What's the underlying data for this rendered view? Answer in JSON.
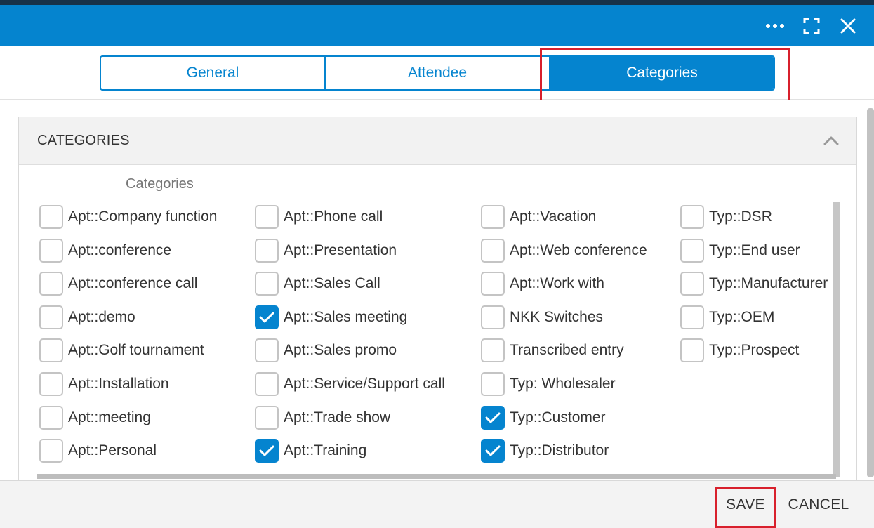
{
  "colors": {
    "accent": "#0584cf",
    "highlight": "#d8202c",
    "titlebar": "#0584cf",
    "top_strip": "#17324a"
  },
  "titlebar": {
    "icons": [
      "more-icon",
      "maximize-icon",
      "close-icon"
    ]
  },
  "tabs": [
    {
      "label": "General",
      "active": false
    },
    {
      "label": "Attendee",
      "active": false
    },
    {
      "label": "Categories",
      "active": true
    }
  ],
  "panel": {
    "title": "CATEGORIES",
    "field_label": "Categories"
  },
  "categories": [
    [
      {
        "label": "Apt::Company function",
        "checked": false
      },
      {
        "label": "Apt::conference",
        "checked": false
      },
      {
        "label": "Apt::conference call",
        "checked": false
      },
      {
        "label": "Apt::demo",
        "checked": false
      },
      {
        "label": "Apt::Golf tournament",
        "checked": false
      },
      {
        "label": "Apt::Installation",
        "checked": false
      },
      {
        "label": "Apt::meeting",
        "checked": false
      },
      {
        "label": "Apt::Personal",
        "checked": false
      }
    ],
    [
      {
        "label": "Apt::Phone call",
        "checked": false
      },
      {
        "label": "Apt::Presentation",
        "checked": false
      },
      {
        "label": "Apt::Sales Call",
        "checked": false
      },
      {
        "label": "Apt::Sales meeting",
        "checked": true
      },
      {
        "label": "Apt::Sales promo",
        "checked": false
      },
      {
        "label": "Apt::Service/Support call",
        "checked": false
      },
      {
        "label": "Apt::Trade show",
        "checked": false
      },
      {
        "label": "Apt::Training",
        "checked": true
      }
    ],
    [
      {
        "label": "Apt::Vacation",
        "checked": false
      },
      {
        "label": "Apt::Web conference",
        "checked": false
      },
      {
        "label": "Apt::Work with",
        "checked": false
      },
      {
        "label": "NKK Switches",
        "checked": false
      },
      {
        "label": "Transcribed entry",
        "checked": false
      },
      {
        "label": "Typ: Wholesaler",
        "checked": false
      },
      {
        "label": "Typ::Customer",
        "checked": true
      },
      {
        "label": "Typ::Distributor",
        "checked": true
      }
    ],
    [
      {
        "label": "Typ::DSR",
        "checked": false
      },
      {
        "label": "Typ::End user",
        "checked": false
      },
      {
        "label": "Typ::Manufacturer",
        "checked": false
      },
      {
        "label": "Typ::OEM",
        "checked": false
      },
      {
        "label": "Typ::Prospect",
        "checked": false
      }
    ]
  ],
  "footer": {
    "save_label": "SAVE",
    "cancel_label": "CANCEL"
  }
}
